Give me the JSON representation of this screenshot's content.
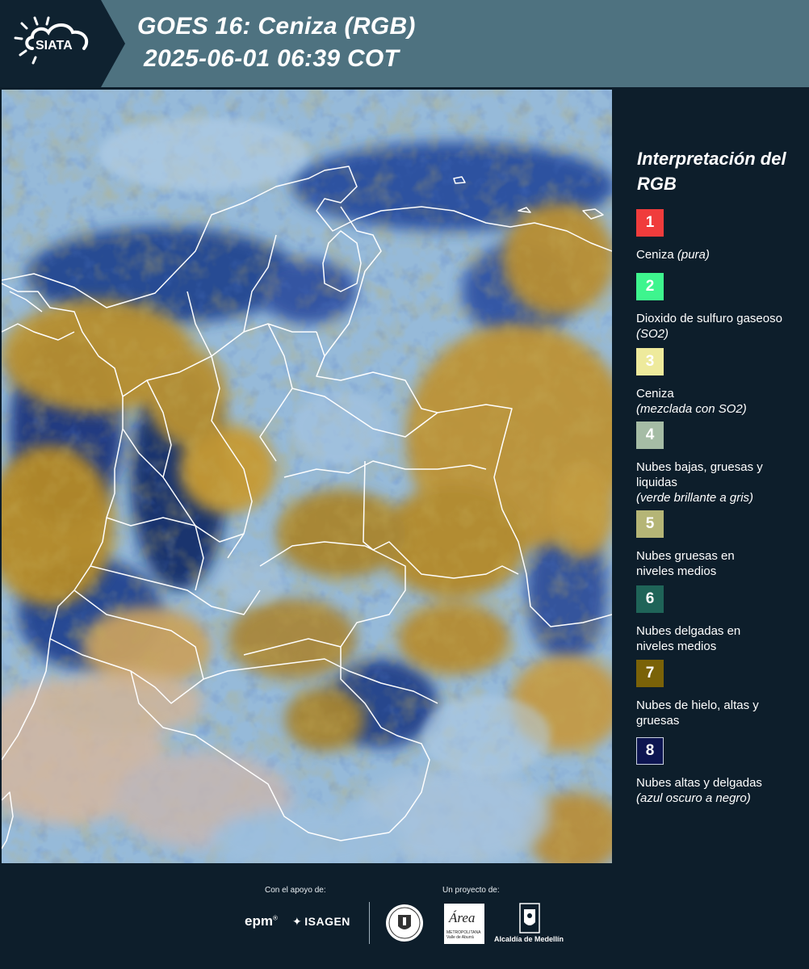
{
  "header": {
    "logo_text": "SIATA",
    "title": "GOES 16: Ceniza (RGB)",
    "datetime": "2025-06-01 06:39 COT"
  },
  "legend": {
    "title": "Interpretación del RGB",
    "items": [
      {
        "number": "1",
        "color": "#f03c3c",
        "number_color": "#ffffff",
        "label": "Ceniza",
        "note": "(pura)"
      },
      {
        "number": "2",
        "color": "#3ef58e",
        "number_color": "#ffffff",
        "label": "Dioxido de sulfuro gaseoso",
        "note": "(SO2)"
      },
      {
        "number": "3",
        "color": "#eeea9c",
        "number_color": "#ffffff",
        "label": "Ceniza",
        "note": "(mezclada con SO2)"
      },
      {
        "number": "4",
        "color": "#a5bca5",
        "number_color": "#ffffff",
        "label": "Nubes bajas, gruesas y liquidas",
        "note": "(verde brillante a gris)"
      },
      {
        "number": "5",
        "color": "#b5b576",
        "number_color": "#ffffff",
        "label": "Nubes gruesas en niveles medios",
        "note": ""
      },
      {
        "number": "6",
        "color": "#1f6458",
        "number_color": "#ffffff",
        "label": "Nubes delgadas en niveles medios",
        "note": ""
      },
      {
        "number": "7",
        "color": "#7a6208",
        "number_color": "#ffffff",
        "label": "Nubes de hielo, altas y gruesas",
        "note": ""
      },
      {
        "number": "8",
        "color": "#0d1551",
        "number_color": "#ffffff",
        "label": "Nubes altas y delgadas",
        "note": "(azul oscuro a negro)"
      }
    ]
  },
  "footer": {
    "support_label": "Con el apoyo de:",
    "project_label": "Un proyecto de:",
    "epm": "epm",
    "epm_mark": "®",
    "isagen": "ISAGEN",
    "area_word": "Área",
    "area_sub": "METROPOLITANA Valle de Aburrá",
    "alcaldia": "Alcaldía de Medellín"
  }
}
